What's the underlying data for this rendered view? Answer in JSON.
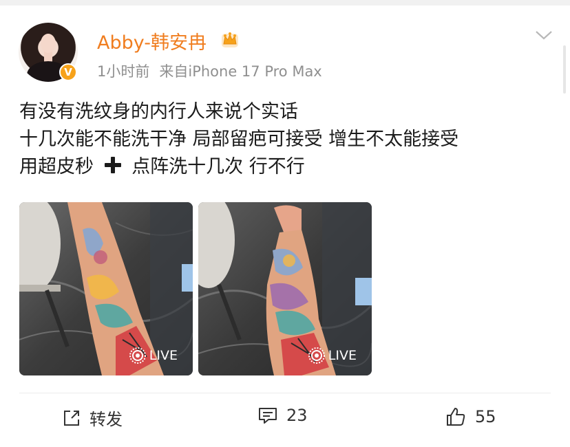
{
  "post": {
    "author": {
      "name": "Abby-韩安冉",
      "avatar_icon": "avatar-photo",
      "verified_badge": "V",
      "member_icon": "crown-icon"
    },
    "time": "1小时前",
    "source": "来自iPhone 17 Pro Max",
    "text_lines": [
      "有没有洗纹身的内行人来说个实话",
      "十几次能不能洗干净 局部留疤可接受 增生不太能接受",
      {
        "before": "用超皮秒",
        "after": "点阵洗十几次 行不行"
      }
    ],
    "images": [
      {
        "badge": "LIVE"
      },
      {
        "badge": "LIVE"
      }
    ]
  },
  "actions": {
    "repost_label": "转发",
    "comment_count": "23",
    "like_count": "55"
  },
  "colors": {
    "username": "#f07d1f",
    "meta": "#8f8f8f",
    "badge": "#f7a21a"
  }
}
